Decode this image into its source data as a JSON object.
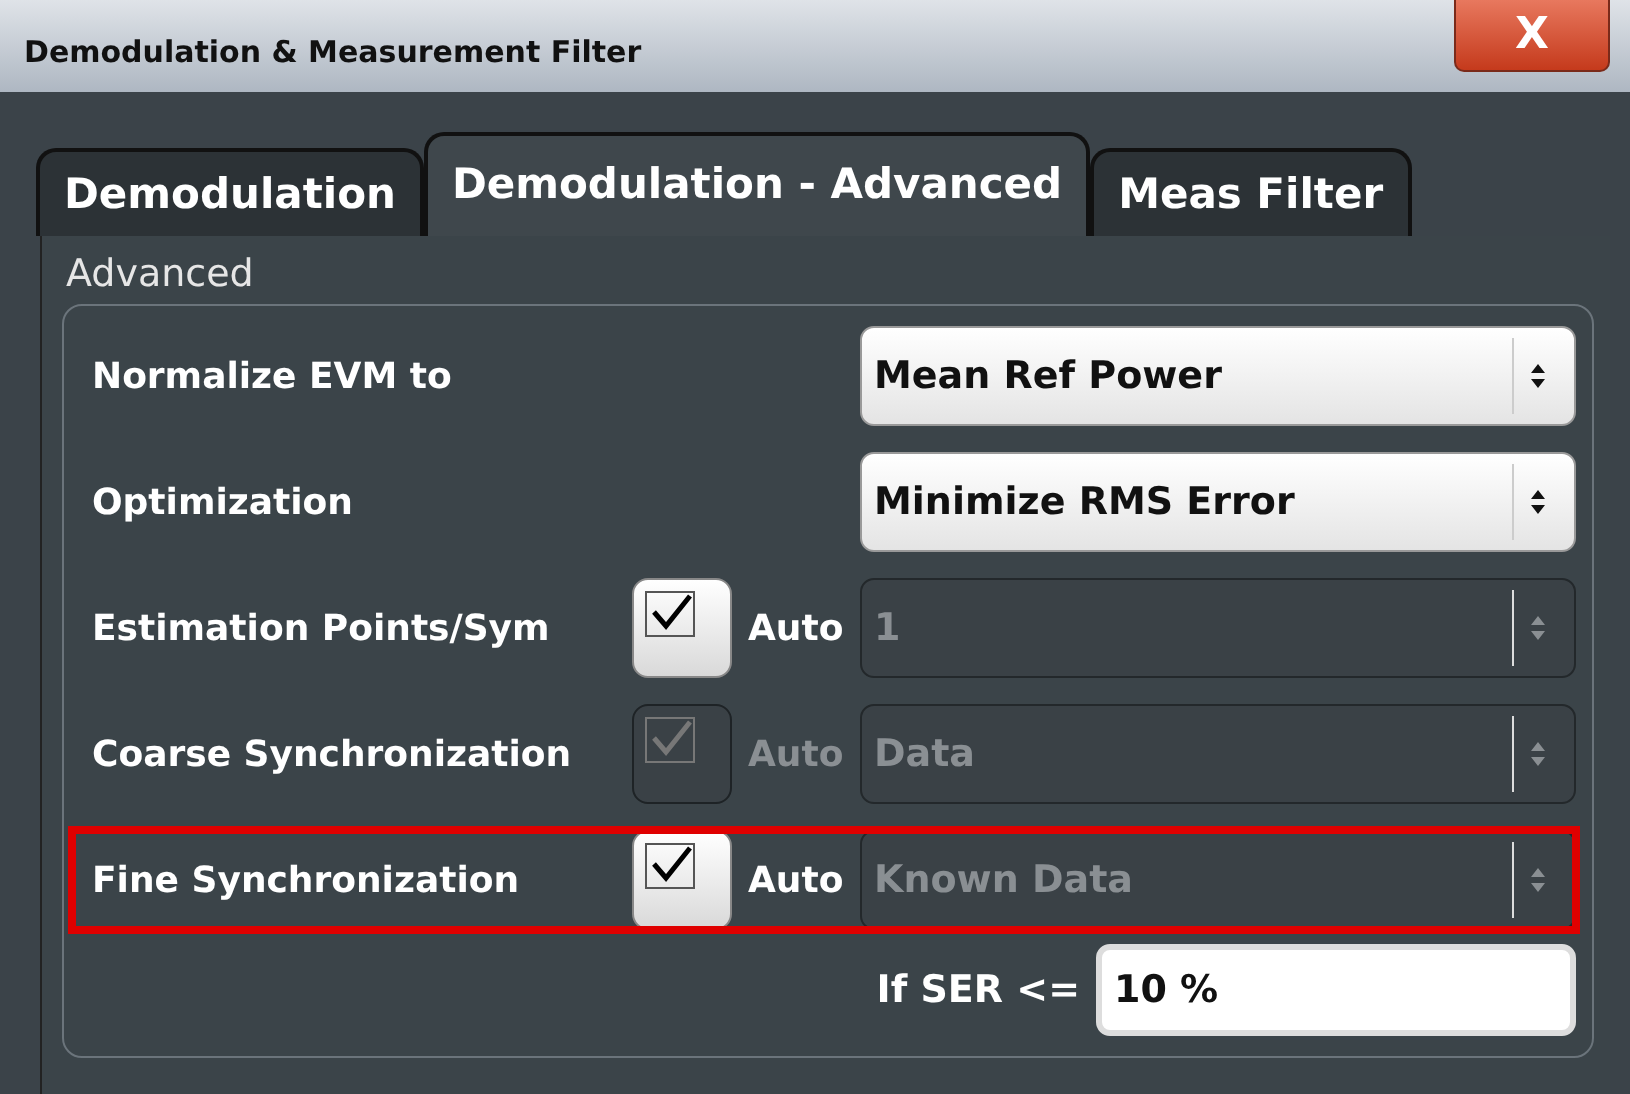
{
  "window": {
    "title": "Demodulation & Measurement Filter",
    "close": "X"
  },
  "tabs": [
    {
      "label": "Demodulation",
      "selected": false
    },
    {
      "label": "Demodulation - Advanced",
      "selected": true
    },
    {
      "label": "Meas Filter",
      "selected": false
    }
  ],
  "section": "Advanced",
  "rows": [
    {
      "kind": "select",
      "label": "Normalize EVM to",
      "value": "Mean Ref Power",
      "highlighted": false
    },
    {
      "kind": "select",
      "label": "Optimization",
      "value": "Minimize RMS Error",
      "highlighted": false
    },
    {
      "kind": "auto",
      "label": "Estimation Points/Sym",
      "auto_label": "Auto",
      "checked": true,
      "disabled": false,
      "value": "1",
      "highlighted": false
    },
    {
      "kind": "auto",
      "label": "Coarse Synchronization",
      "auto_label": "Auto",
      "checked": true,
      "disabled": true,
      "value": "Data",
      "highlighted": false
    },
    {
      "kind": "auto",
      "label": "Fine Synchronization",
      "auto_label": "Auto",
      "checked": true,
      "disabled": false,
      "value": "Known Data",
      "highlighted": true
    }
  ],
  "ser": {
    "label": "If SER <=",
    "value": "10 %"
  }
}
